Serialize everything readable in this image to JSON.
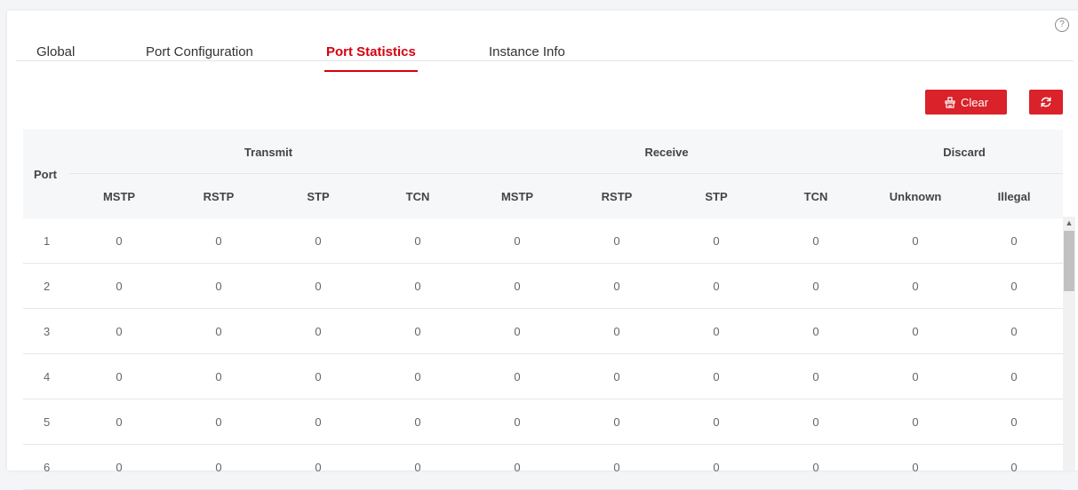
{
  "tabs": [
    {
      "label": "Global"
    },
    {
      "label": "Port Configuration"
    },
    {
      "label": "Port Statistics"
    },
    {
      "label": "Instance Info"
    }
  ],
  "active_tab": "Port Statistics",
  "help_glyph": "?",
  "toolbar": {
    "clear_label": "Clear",
    "refresh_icon": "refresh-icon"
  },
  "table": {
    "port_header": "Port",
    "groups": [
      "Transmit",
      "Receive",
      "Discard"
    ],
    "columns": [
      "MSTP",
      "RSTP",
      "STP",
      "TCN",
      "MSTP",
      "RSTP",
      "STP",
      "TCN",
      "Unknown",
      "Illegal"
    ],
    "rows": [
      {
        "port": "1",
        "values": [
          "0",
          "0",
          "0",
          "0",
          "0",
          "0",
          "0",
          "0",
          "0",
          "0"
        ]
      },
      {
        "port": "2",
        "values": [
          "0",
          "0",
          "0",
          "0",
          "0",
          "0",
          "0",
          "0",
          "0",
          "0"
        ]
      },
      {
        "port": "3",
        "values": [
          "0",
          "0",
          "0",
          "0",
          "0",
          "0",
          "0",
          "0",
          "0",
          "0"
        ]
      },
      {
        "port": "4",
        "values": [
          "0",
          "0",
          "0",
          "0",
          "0",
          "0",
          "0",
          "0",
          "0",
          "0"
        ]
      },
      {
        "port": "5",
        "values": [
          "0",
          "0",
          "0",
          "0",
          "0",
          "0",
          "0",
          "0",
          "0",
          "0"
        ]
      },
      {
        "port": "6",
        "values": [
          "0",
          "0",
          "0",
          "0",
          "0",
          "0",
          "0",
          "0",
          "0",
          "0"
        ]
      }
    ]
  },
  "colors": {
    "accent": "#d7000f",
    "button": "#d9222a",
    "header_bg": "#f6f7f9"
  }
}
